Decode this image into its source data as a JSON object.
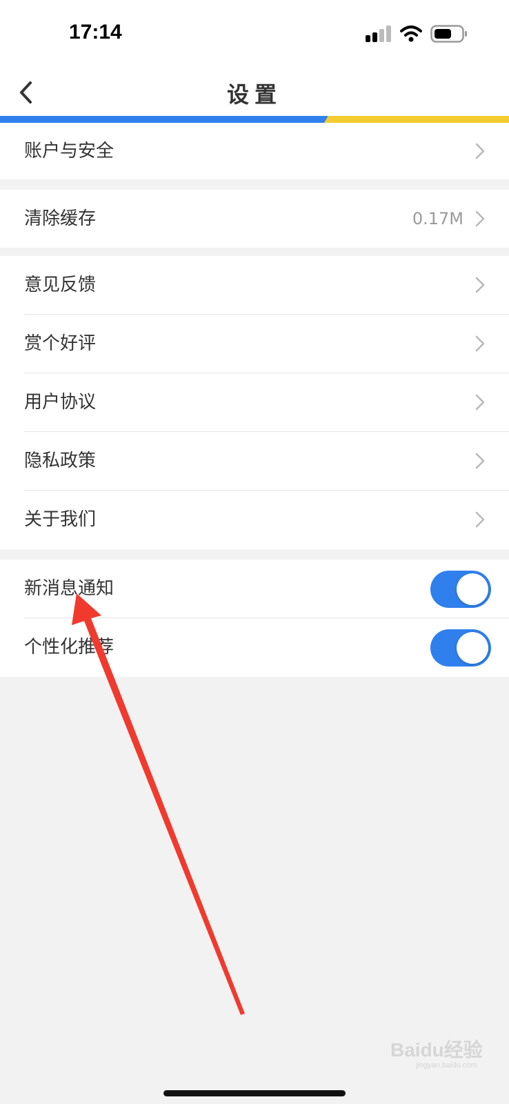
{
  "status_bar": {
    "time": "17:14"
  },
  "header": {
    "title": "设置"
  },
  "groups": [
    {
      "items": [
        {
          "label": "账户与安全"
        }
      ]
    },
    {
      "items": [
        {
          "label": "清除缓存",
          "value": "0.17M"
        }
      ]
    },
    {
      "items": [
        {
          "label": "意见反馈"
        },
        {
          "label": "赏个好评"
        },
        {
          "label": "用户协议"
        },
        {
          "label": "隐私政策"
        },
        {
          "label": "关于我们"
        }
      ]
    },
    {
      "items": [
        {
          "label": "新消息通知",
          "toggle": "on"
        },
        {
          "label": "个性化推荐",
          "toggle": "on"
        }
      ]
    }
  ],
  "watermark": {
    "brand": "Baidu经验",
    "sub": "jingyan.baidu.com"
  },
  "colors": {
    "accent_blue": "#2f80ed",
    "accent_yellow": "#f5cc30",
    "annotation_red": "#f03a2e"
  }
}
